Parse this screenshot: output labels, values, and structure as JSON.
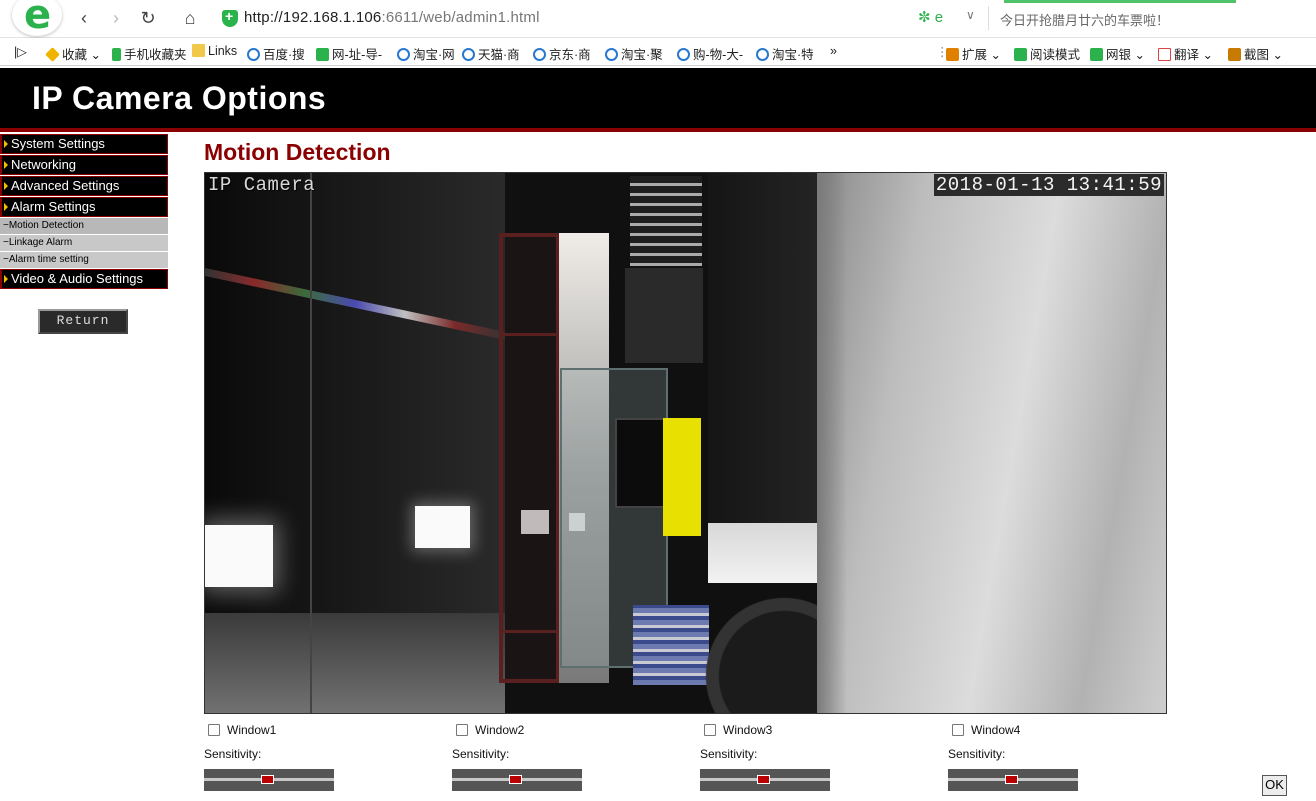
{
  "browser": {
    "url_host": "http://192.168.1.106",
    "url_port_path": ":6611/web/admin1.html",
    "search_hint": "今日开抢腊月廿六的车票啦！"
  },
  "favorites": [
    {
      "label": "收藏",
      "icon": "star-icon"
    },
    {
      "label": "手机收藏夹",
      "icon": "phone-icon"
    },
    {
      "label": "Links",
      "icon": "folder-icon"
    },
    {
      "label": "百度·搜",
      "icon": "ie-icon"
    },
    {
      "label": "网-址-导-",
      "icon": "site-icon"
    },
    {
      "label": "淘宝·网",
      "icon": "ie-icon"
    },
    {
      "label": "天猫·商",
      "icon": "ie-icon"
    },
    {
      "label": "京东·商",
      "icon": "ie-icon"
    },
    {
      "label": "淘宝·聚",
      "icon": "ie-icon"
    },
    {
      "label": "购-物-大-",
      "icon": "ie-icon"
    },
    {
      "label": "淘宝·特",
      "icon": "ie-icon"
    }
  ],
  "more_glyph": "»",
  "toolbar_right": [
    {
      "label": "扩展",
      "icon": "extension-icon"
    },
    {
      "label": "阅读模式",
      "icon": "read-mode-icon"
    },
    {
      "label": "网银",
      "icon": "bank-icon"
    },
    {
      "label": "翻译",
      "icon": "translate-icon"
    },
    {
      "label": "截图",
      "icon": "screenshot-icon"
    }
  ],
  "app": {
    "title": "IP Camera Options",
    "section_title": "Motion Detection",
    "menu": [
      {
        "label": "System Settings"
      },
      {
        "label": "Networking"
      },
      {
        "label": "Advanced Settings"
      },
      {
        "label": "Alarm Settings"
      }
    ],
    "submenu": [
      {
        "label": "−Motion Detection"
      },
      {
        "label": "−Linkage Alarm"
      },
      {
        "label": "−Alarm time setting"
      }
    ],
    "menu_last": {
      "label": "Video & Audio Settings"
    },
    "return_label": "Return",
    "camera": {
      "osd_name": "IP Camera",
      "osd_timestamp": "2018-01-13 13:41:59"
    },
    "sensitivity_label": "Sensitivity:",
    "windows": [
      {
        "label": "Window1",
        "checked": false,
        "sensitivity_pct": 49
      },
      {
        "label": "Window2",
        "checked": false,
        "sensitivity_pct": 49
      },
      {
        "label": "Window3",
        "checked": false,
        "sensitivity_pct": 49
      },
      {
        "label": "Window4",
        "checked": false,
        "sensitivity_pct": 49
      }
    ],
    "ok_label": "OK"
  },
  "colors": {
    "accent": "#8b0000",
    "header_bg": "#000000",
    "slider_thumb": "#bb0000"
  }
}
